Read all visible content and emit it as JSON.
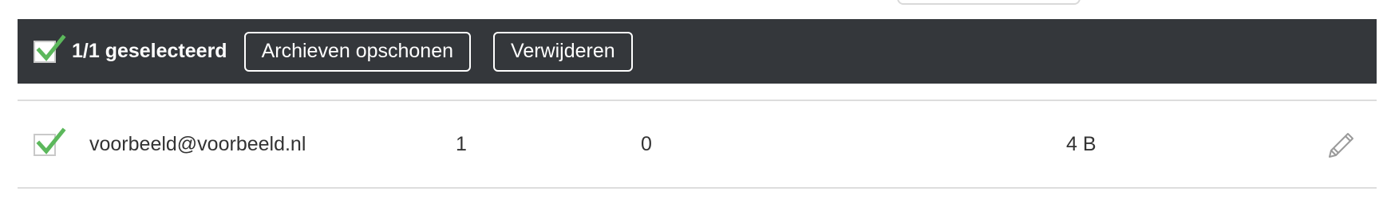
{
  "bulk_bar": {
    "selected_label": "1/1 geselecteerd",
    "clean_archives_label": "Archieven opschonen",
    "delete_label": "Verwijderen",
    "checkbox_checked": true
  },
  "rows": [
    {
      "checked": true,
      "email": "voorbeeld@voorbeeld.nl",
      "count_a": "1",
      "count_b": "0",
      "size": "4 B"
    }
  ],
  "icons": {
    "check": "check-icon",
    "edit": "pencil-icon"
  },
  "colors": {
    "bar_background": "#34373b",
    "check_green": "#5cb85c",
    "divider": "#dddddd",
    "text": "#333333"
  }
}
